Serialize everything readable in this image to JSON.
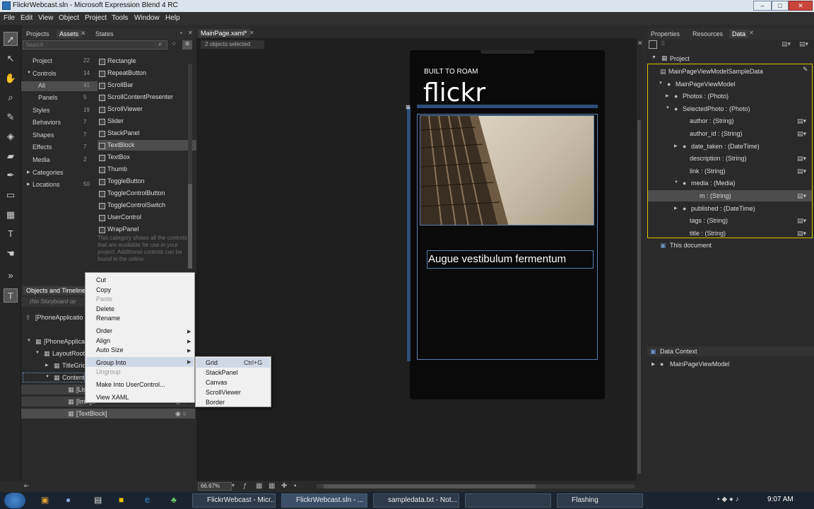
{
  "window": {
    "title": "FlickrWebcast.sln - Microsoft Expression Blend 4 RC",
    "min": "–",
    "max": "□",
    "close": "✕"
  },
  "menu": [
    "File",
    "Edit",
    "View",
    "Object",
    "Project",
    "Tools",
    "Window",
    "Help"
  ],
  "assets_panel": {
    "tabs": [
      "Projects",
      "Assets",
      "States"
    ],
    "search_placeholder": "Search",
    "categories": [
      {
        "label": "Project",
        "count": "22"
      },
      {
        "label": "Controls",
        "count": "14"
      },
      {
        "label": "All",
        "count": "41"
      },
      {
        "label": "Panels",
        "count": "5"
      },
      {
        "label": "Styles",
        "count": "19"
      },
      {
        "label": "Behaviors",
        "count": "7"
      },
      {
        "label": "Shapes",
        "count": "7"
      },
      {
        "label": "Effects",
        "count": "7"
      },
      {
        "label": "Media",
        "count": "2"
      },
      {
        "label": "Categories",
        "count": ""
      },
      {
        "label": "Locations",
        "count": "50"
      }
    ],
    "items": [
      "Rectangle",
      "RepeatButton",
      "ScrollBar",
      "ScrollContentPresenter",
      "ScrollViewer",
      "Slider",
      "StackPanel",
      "TextBlock",
      "TextBox",
      "Thumb",
      "ToggleButton",
      "ToggleControlButton",
      "ToggleControlSwitch",
      "UserControl",
      "WrapPanel"
    ],
    "description": "This category shows all the controls that are available for use in your project. Additional controls can be found in the online"
  },
  "objects_panel": {
    "title": "Objects and Timeline",
    "storyboard": "(No Storyboard op",
    "root": "[PhoneApplicatio",
    "tree": [
      "[PhoneApplicat",
      "LayoutRoot",
      "TitleGrid",
      "ContentG",
      "[ListBo",
      "[Image",
      "[TextBlock]"
    ]
  },
  "context_menu": {
    "items": [
      {
        "label": "Cut",
        "disabled": false
      },
      {
        "label": "Copy",
        "disabled": false
      },
      {
        "label": "Paste",
        "disabled": true
      },
      {
        "label": "Delete",
        "disabled": false
      },
      {
        "label": "Rename",
        "disabled": false
      },
      {
        "label": "Order",
        "disabled": false
      },
      {
        "label": "Align",
        "disabled": false
      },
      {
        "label": "Auto Size",
        "disabled": false
      },
      {
        "label": "Group Into",
        "disabled": false
      },
      {
        "label": "Ungroup",
        "disabled": true
      },
      {
        "label": "Make Into UserControl...",
        "disabled": false
      },
      {
        "label": "View XAML",
        "disabled": false
      }
    ],
    "submenu": [
      "Grid",
      "StackPanel",
      "Canvas",
      "ScrollViewer",
      "Border"
    ],
    "submenu_shortcut": "Ctrl+G"
  },
  "document": {
    "tab": "MainPage.xaml*",
    "selection_status": "2 objects selected",
    "app_title": "BUILT TO ROAM",
    "page_title": "flickr",
    "text_block": "Augue vestibulum fermentum",
    "zoom": "66.67%"
  },
  "data_panel": {
    "tabs": [
      "Properties",
      "Resources",
      "Data"
    ],
    "project_label": "Project",
    "tree": [
      "MainPageViewModelSampleData",
      "MainPageViewModel",
      "Photos : (Photo)",
      "SelectedPhoto : (Photo)",
      "author : (String)",
      "author_id : (String)",
      "date_taken : (DateTime)",
      "description : (String)",
      "link : (String)",
      "media : (Media)",
      "m : (String)",
      "published : (DateTime)",
      "tags : (String)",
      "title : (String)"
    ],
    "this_document": "This document",
    "data_context_title": "Data Context",
    "data_context_item": "MainPageViewModel"
  },
  "taskbar": {
    "buttons": [
      "FlickrWebcast - Micr...",
      "FlickrWebcast.sln - ...",
      "sampledata.txt - Not...",
      "",
      "Flashing"
    ],
    "clock": "9:07 AM"
  },
  "colors": {
    "accent_yellow": "#d8c400",
    "selection_blue": "#5a7fb0",
    "menu_bg": "#f0f0f0"
  }
}
